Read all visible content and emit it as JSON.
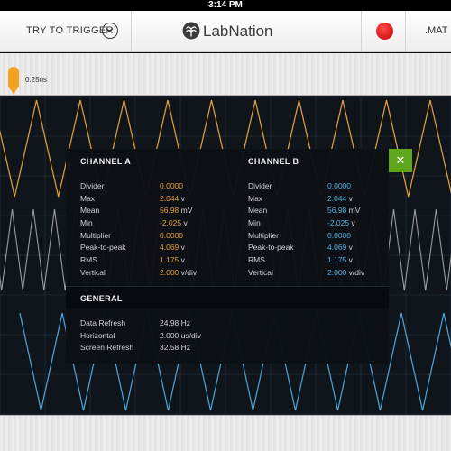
{
  "status": {
    "time": "3:14 PM"
  },
  "toolbar": {
    "trigger_label": "TRY TO TRIGGER",
    "brand": "LabNation",
    "file_format": ".MAT"
  },
  "marker": {
    "label": "0.25ns"
  },
  "colors": {
    "channel_a": "#e8a33b",
    "channel_b": "#55b2e0",
    "close_button": "#5ea61c",
    "record": "#d90000"
  },
  "panel": {
    "channel_a": {
      "title": "CHANNEL A",
      "rows": [
        {
          "label": "Divider",
          "value": "0.0000",
          "unit": ""
        },
        {
          "label": "Max",
          "value": "2.044",
          "unit": " v"
        },
        {
          "label": "Mean",
          "value": "56.98",
          "unit": " mV"
        },
        {
          "label": "Min",
          "value": "-2.025",
          "unit": " v"
        },
        {
          "label": "Multiplier",
          "value": "0.0000",
          "unit": ""
        },
        {
          "label": "Peak-to-peak",
          "value": "4.069",
          "unit": " v"
        },
        {
          "label": "RMS",
          "value": "1.175",
          "unit": " v"
        },
        {
          "label": "Vertical",
          "value": "2.000",
          "unit": " v/div"
        }
      ]
    },
    "channel_b": {
      "title": "CHANNEL B",
      "rows": [
        {
          "label": "Divider",
          "value": "0.0000",
          "unit": ""
        },
        {
          "label": "Max",
          "value": "2.044",
          "unit": " v"
        },
        {
          "label": "Mean",
          "value": "56.98",
          "unit": " mV"
        },
        {
          "label": "Min",
          "value": "-2.025",
          "unit": " v"
        },
        {
          "label": "Multiplier",
          "value": "0.0000",
          "unit": ""
        },
        {
          "label": "Peak-to-peak",
          "value": "4.069",
          "unit": " v"
        },
        {
          "label": "RMS",
          "value": "1.175",
          "unit": " v"
        },
        {
          "label": "Vertical",
          "value": "2.000",
          "unit": " v/div"
        }
      ]
    },
    "general": {
      "title": "GENERAL",
      "rows": [
        {
          "label": "Data Refresh",
          "value": "24.98 Hz"
        },
        {
          "label": "Horizontal",
          "value": "2.000 us/div"
        },
        {
          "label": "Screen Refresh",
          "value": "32.58 Hz"
        }
      ]
    },
    "close_icon": "close-icon"
  }
}
